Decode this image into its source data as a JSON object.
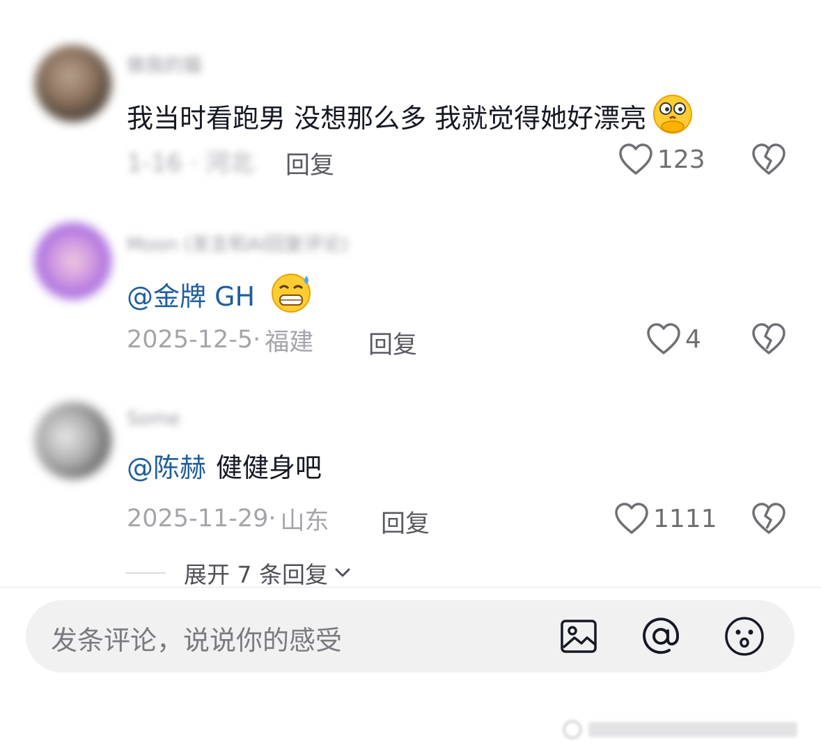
{
  "comments": [
    {
      "username": "做我的猫",
      "text": "我当时看跑男 没想那么多 我就觉得她好漂亮",
      "emoji": "thinking-hands-emoji",
      "meta_hidden": "1-16 · 河北",
      "reply_label": "回复",
      "likes": "123"
    },
    {
      "username": "Moon (发言和AI回复评论)",
      "mention": "@金牌 GH",
      "text": "",
      "emoji": "grinning-sweat-emoji",
      "date": "2025-12-5",
      "location": "福建",
      "reply_label": "回复",
      "likes": "4"
    },
    {
      "username": "Some",
      "mention": "@陈赫",
      "text": "健健身吧",
      "date": "2025-11-29",
      "location": "山东",
      "reply_label": "回复",
      "likes": "1111"
    }
  ],
  "expand_replies": "展开 7 条回复",
  "input": {
    "placeholder": "发条评论，说说你的感受",
    "icons": [
      "image-icon",
      "at-icon",
      "emoji-icon"
    ]
  },
  "colors": {
    "mention": "#1f5e9c",
    "meta": "#a4a4ab",
    "input_bg": "#f1f1f2"
  }
}
